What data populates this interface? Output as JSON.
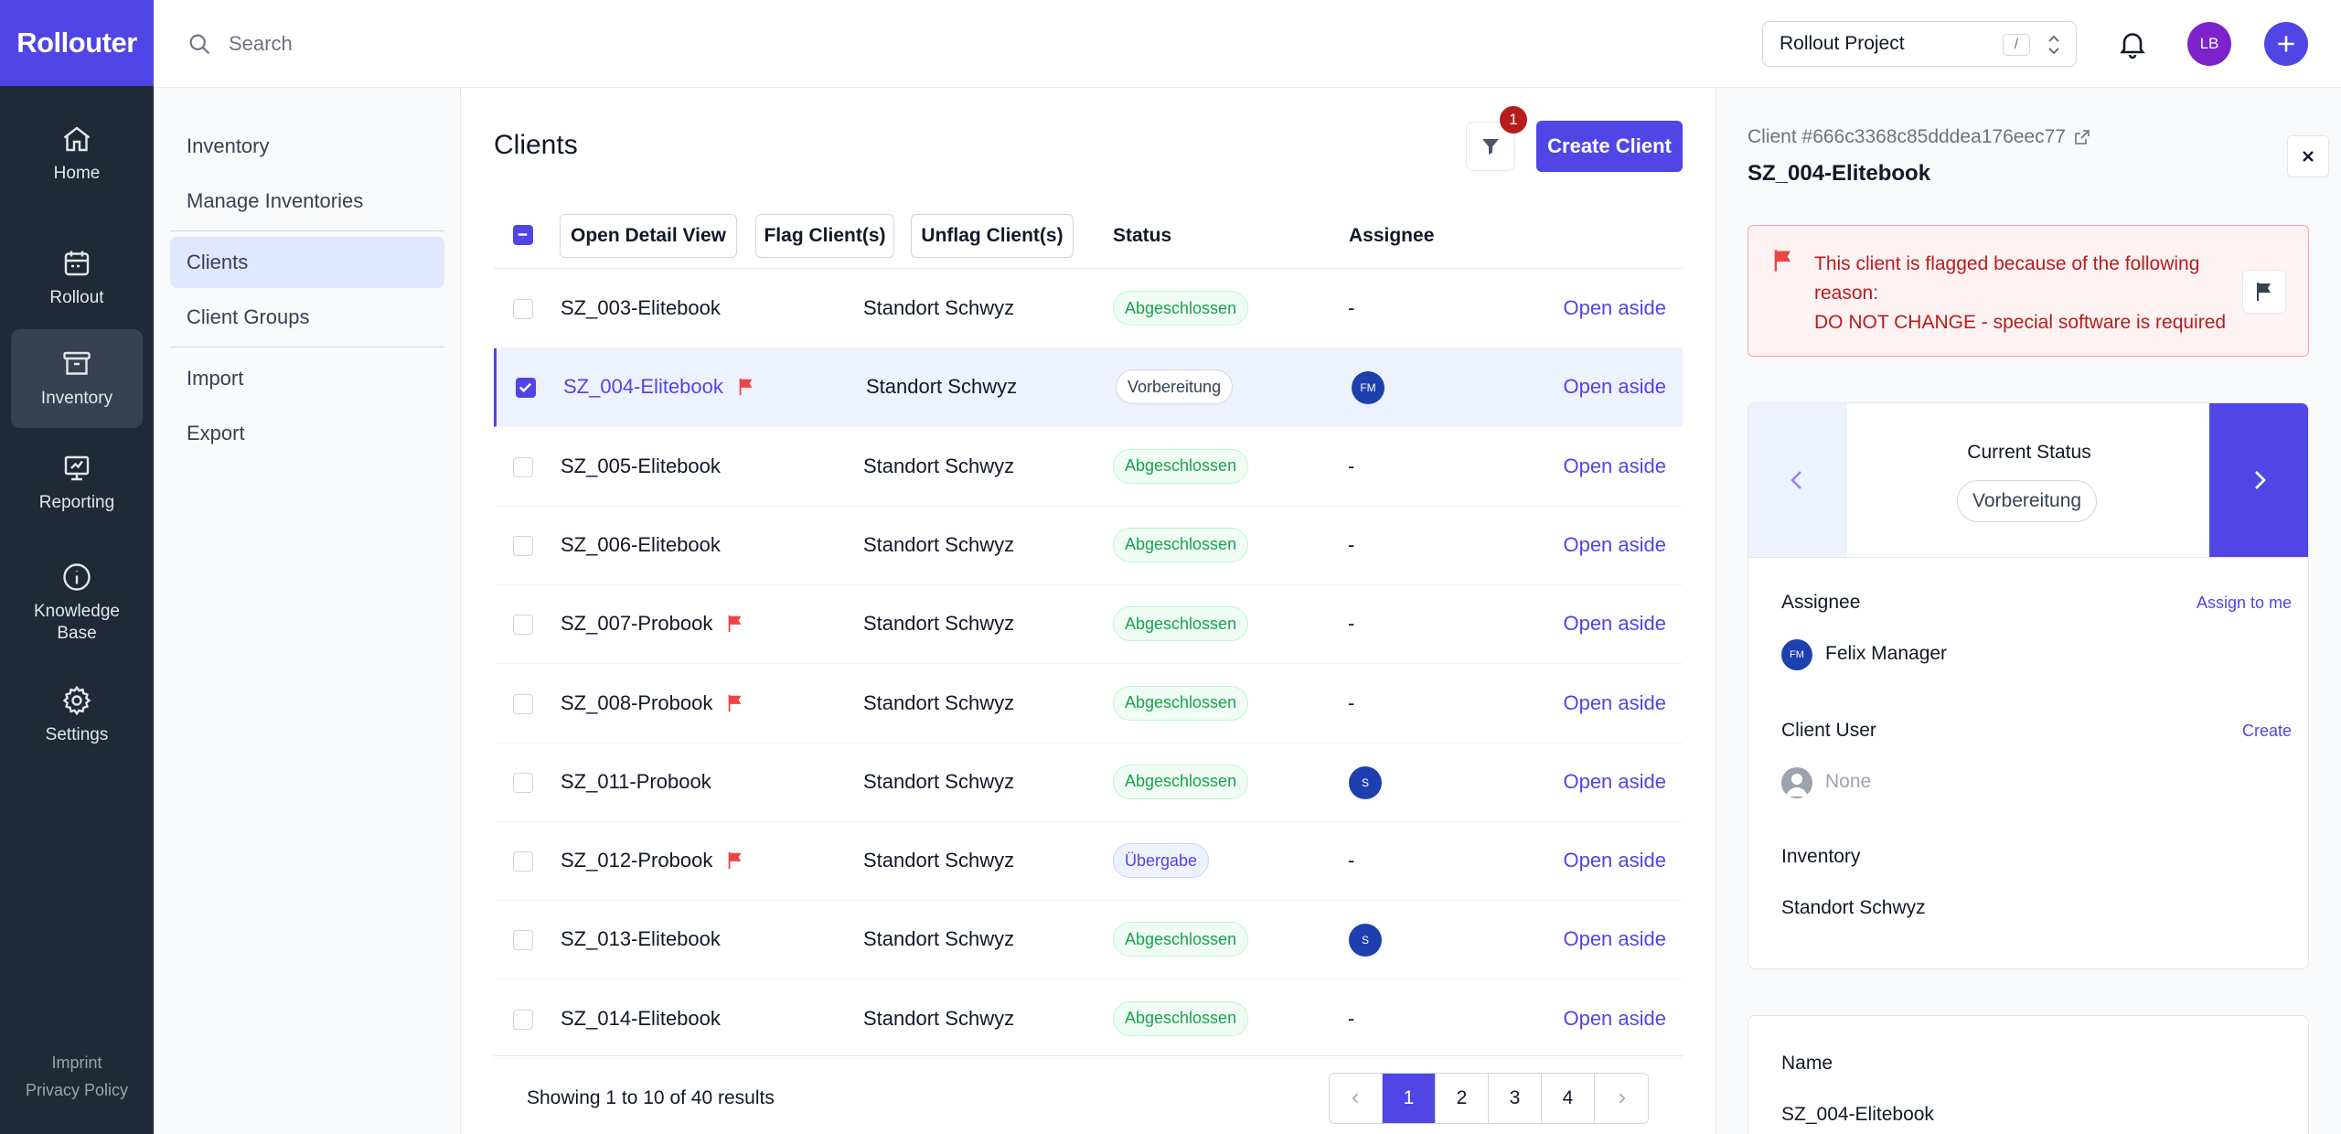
{
  "app": {
    "logo": "Rollouter"
  },
  "rail": {
    "items": [
      {
        "label": "Home",
        "icon": "home-icon"
      },
      {
        "label": "Rollout",
        "icon": "calendar-icon"
      },
      {
        "label": "Inventory",
        "icon": "archive-icon"
      },
      {
        "label": "Reporting",
        "icon": "presentation-chart-icon"
      },
      {
        "label": "Knowledge Base",
        "icon": "info-circle-icon"
      },
      {
        "label": "Settings",
        "icon": "gear-icon"
      }
    ],
    "active": "Inventory",
    "footer": {
      "imprint": "Imprint",
      "privacy": "Privacy Policy"
    }
  },
  "topbar": {
    "search_placeholder": "Search",
    "project": "Rollout Project",
    "project_shortcut": "/",
    "user_initials": "LB"
  },
  "subnav": {
    "items": [
      "Inventory",
      "Manage Inventories",
      "Clients",
      "Client Groups",
      "Import",
      "Export"
    ],
    "active": "Clients"
  },
  "main": {
    "title": "Clients",
    "filter_count": "1",
    "create_label": "Create Client",
    "bulk_actions": {
      "open_detail": "Open Detail View",
      "flag": "Flag Client(s)",
      "unflag": "Unflag Client(s)"
    },
    "columns": {
      "status": "Status",
      "assignee": "Assignee"
    },
    "open_aside_label": "Open aside",
    "rows": [
      {
        "name": "SZ_003-Elitebook",
        "flagged": false,
        "selected": false,
        "inventory": "Standort Schwyz",
        "status": "Abgeschlossen",
        "status_kind": "done",
        "assignee": "-"
      },
      {
        "name": "SZ_004-Elitebook",
        "flagged": true,
        "selected": true,
        "inventory": "Standort Schwyz",
        "status": "Vorbereitung",
        "status_kind": "prep",
        "assignee_avatar": "FM"
      },
      {
        "name": "SZ_005-Elitebook",
        "flagged": false,
        "selected": false,
        "inventory": "Standort Schwyz",
        "status": "Abgeschlossen",
        "status_kind": "done",
        "assignee": "-"
      },
      {
        "name": "SZ_006-Elitebook",
        "flagged": false,
        "selected": false,
        "inventory": "Standort Schwyz",
        "status": "Abgeschlossen",
        "status_kind": "done",
        "assignee": "-"
      },
      {
        "name": "SZ_007-Probook",
        "flagged": true,
        "selected": false,
        "inventory": "Standort Schwyz",
        "status": "Abgeschlossen",
        "status_kind": "done",
        "assignee": "-"
      },
      {
        "name": "SZ_008-Probook",
        "flagged": true,
        "selected": false,
        "inventory": "Standort Schwyz",
        "status": "Abgeschlossen",
        "status_kind": "done",
        "assignee": "-"
      },
      {
        "name": "SZ_011-Probook",
        "flagged": false,
        "selected": false,
        "inventory": "Standort Schwyz",
        "status": "Abgeschlossen",
        "status_kind": "done",
        "assignee_avatar": "S"
      },
      {
        "name": "SZ_012-Probook",
        "flagged": true,
        "selected": false,
        "inventory": "Standort Schwyz",
        "status": "Übergabe",
        "status_kind": "hand",
        "assignee": "-"
      },
      {
        "name": "SZ_013-Elitebook",
        "flagged": false,
        "selected": false,
        "inventory": "Standort Schwyz",
        "status": "Abgeschlossen",
        "status_kind": "done",
        "assignee_avatar": "S"
      },
      {
        "name": "SZ_014-Elitebook",
        "flagged": false,
        "selected": false,
        "inventory": "Standort Schwyz",
        "status": "Abgeschlossen",
        "status_kind": "done",
        "assignee": "-"
      }
    ],
    "results_text": "Showing 1 to 10 of 40 results",
    "pages": [
      "1",
      "2",
      "3",
      "4"
    ],
    "current_page": "1"
  },
  "aside": {
    "client_id": "Client #666c3368c85dddea176eec77",
    "title": "SZ_004-Elitebook",
    "flag_message_1": "This client is flagged because of the following reason:",
    "flag_message_2": "DO NOT CHANGE - special software is required",
    "current_status_label": "Current Status",
    "current_status": "Vorbereitung",
    "assignee_label": "Assignee",
    "assign_to_me": "Assign to me",
    "assignee_name": "Felix Manager",
    "assignee_initials": "FM",
    "client_user_label": "Client User",
    "create_label": "Create",
    "client_user_value": "None",
    "inventory_label": "Inventory",
    "inventory_value": "Standort Schwyz",
    "name_label": "Name",
    "name_value": "SZ_004-Elitebook"
  },
  "colors": {
    "brand": "#4f46e5",
    "rail": "#1f2937",
    "flag": "#ef4444",
    "done": "#16a34a"
  }
}
